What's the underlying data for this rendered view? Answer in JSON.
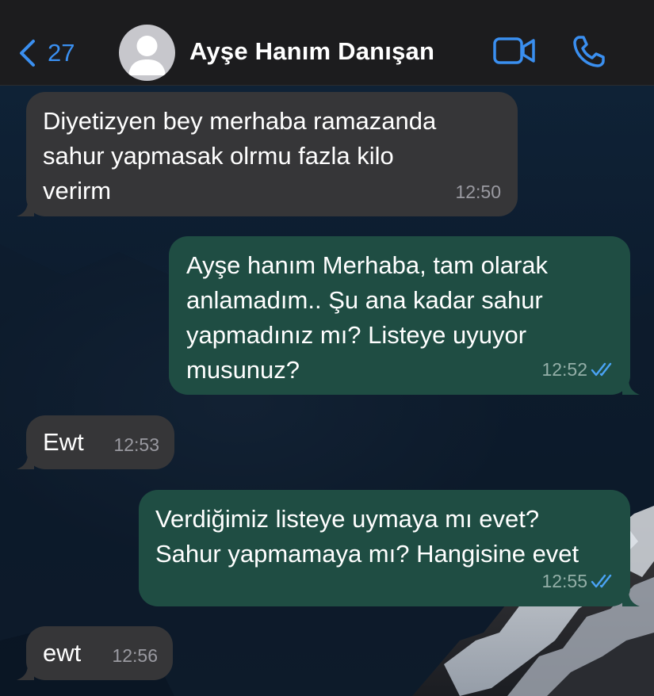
{
  "header": {
    "back_count": "27",
    "contact_name": "Ayşe Hanım Danışan",
    "accent_color": "#3a8ff0",
    "icons": [
      "chevron-left-icon",
      "person-icon",
      "video-camera-icon",
      "phone-icon"
    ]
  },
  "messages": [
    {
      "direction": "incoming",
      "text": "Diyetizyen bey merhaba ramazanda\nsahur yapmasak olrmu fazla kilo\nverirm",
      "time": "12:50"
    },
    {
      "direction": "outgoing",
      "text": "Ayşe hanım Merhaba, tam olarak\nanlamadım.. Şu ana kadar sahur\nyapmadınız mı? Listeye uyuyor\nmusunuz?",
      "time": "12:52",
      "status": "read"
    },
    {
      "direction": "incoming",
      "text": "Ewt",
      "time": "12:53"
    },
    {
      "direction": "outgoing",
      "text": "Verdiğimiz listeye uymaya mı evet?\nSahur yapmamaya mı? Hangisine evet",
      "time": "12:55",
      "status": "read"
    },
    {
      "direction": "incoming",
      "text": "ewt",
      "time": "12:56"
    }
  ],
  "colors": {
    "incoming_bubble": "#363638",
    "outgoing_bubble": "#1f4d43",
    "read_ticks": "#4aa3f5"
  }
}
